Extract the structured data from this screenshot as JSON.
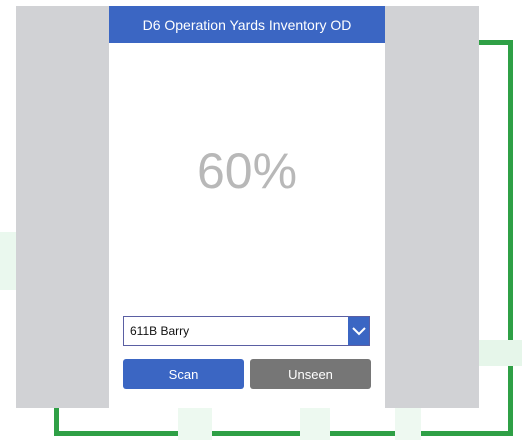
{
  "app": {
    "title": "D6 Operation Yards Inventory OD",
    "progress_percent": 60,
    "progress_label": "60%"
  },
  "location_select": {
    "selected": "611B Barry",
    "icon": "chevron-down-icon"
  },
  "actions": {
    "scan_label": "Scan",
    "unseen_label": "Unseen"
  },
  "colors": {
    "accent": "#3b66c3",
    "secondary_button": "#767676",
    "frame_green": "#2fa046",
    "side_panel": "#d1d2d5",
    "percent_text": "#b8b8b8"
  }
}
